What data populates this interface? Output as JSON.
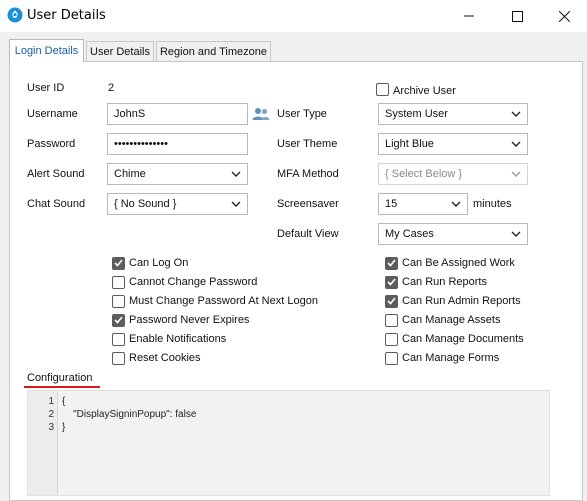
{
  "window": {
    "title": "User Details"
  },
  "tabs": [
    {
      "label": "Login Details",
      "active": true
    },
    {
      "label": "User Details",
      "active": false
    },
    {
      "label": "Region and Timezone",
      "active": false
    }
  ],
  "form": {
    "user_id_label": "User ID",
    "user_id_value": "2",
    "username_label": "Username",
    "username_value": "JohnS",
    "password_label": "Password",
    "password_value": "••••••••••••••",
    "alert_sound_label": "Alert Sound",
    "alert_sound_value": "Chime",
    "chat_sound_label": "Chat Sound",
    "chat_sound_value": "{ No Sound }",
    "archive_user_label": "Archive User",
    "archive_user_checked": false,
    "user_type_label": "User Type",
    "user_type_value": "System User",
    "user_theme_label": "User Theme",
    "user_theme_value": "Light Blue",
    "mfa_method_label": "MFA Method",
    "mfa_method_value": "{ Select Below }",
    "screensaver_label": "Screensaver",
    "screensaver_value": "15",
    "screensaver_unit": "minutes",
    "default_view_label": "Default View",
    "default_view_value": "My Cases"
  },
  "checkboxes_left": [
    {
      "label": "Can Log On",
      "checked": true
    },
    {
      "label": "Cannot Change Password",
      "checked": false
    },
    {
      "label": "Must Change Password At Next Logon",
      "checked": false
    },
    {
      "label": "Password Never Expires",
      "checked": true
    },
    {
      "label": "Enable Notifications",
      "checked": false
    },
    {
      "label": "Reset Cookies",
      "checked": false
    }
  ],
  "checkboxes_right": [
    {
      "label": "Can Be Assigned Work",
      "checked": true
    },
    {
      "label": "Can Run Reports",
      "checked": true
    },
    {
      "label": "Can Run Admin Reports",
      "checked": true
    },
    {
      "label": "Can Manage Assets",
      "checked": false
    },
    {
      "label": "Can Manage Documents",
      "checked": false
    },
    {
      "label": "Can Manage Forms",
      "checked": false
    }
  ],
  "configuration": {
    "label": "Configuration",
    "line_numbers": [
      "1",
      "2",
      "3"
    ],
    "lines": [
      "{",
      "    \"DisplaySigninPopup\": false",
      "}"
    ]
  },
  "icons": {
    "app": "app-logo-icon",
    "users": "users-icon",
    "dropdown": "chevron-down-icon",
    "check": "checkmark-icon"
  },
  "colors": {
    "accent": "#1b5faa",
    "config_underline": "#d41a1a",
    "checkbox_checked": "#5c5c5c",
    "users_icon": "#5a8fc0"
  }
}
